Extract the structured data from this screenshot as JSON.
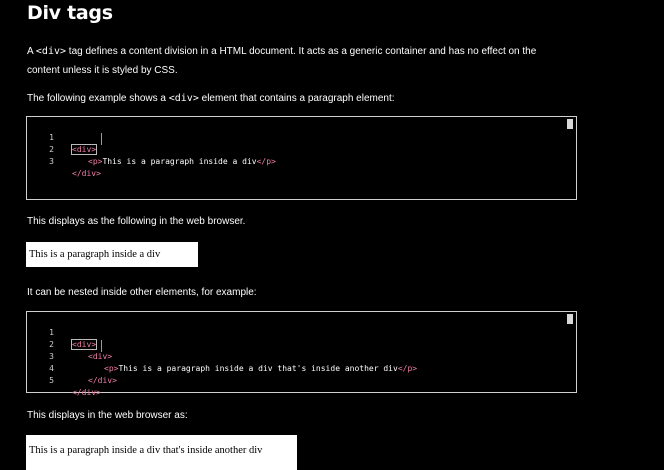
{
  "title": "Div tags",
  "intro": {
    "before": "A ",
    "code": "<div>",
    "after": " tag defines a content division in a HTML document. It acts as a generic container and has no effect on the content unless it is styled by CSS."
  },
  "example_intro": {
    "before": "The following example shows a ",
    "code": "<div>",
    "after": " element that contains a paragraph element:"
  },
  "editor1": {
    "lines": [
      {
        "num": "1",
        "open": "<div>",
        "text": "",
        "close": ""
      },
      {
        "num": "2",
        "open": "<p>",
        "text": "This is a paragraph inside a div",
        "close": "</p>"
      },
      {
        "num": "3",
        "open": "</div>",
        "text": "",
        "close": ""
      }
    ]
  },
  "displays_label": "This displays as the following in the web browser.",
  "output1": "This is a paragraph inside a div",
  "nested_label": "It can be nested inside other elements, for example:",
  "editor2": {
    "lines": [
      {
        "num": "1",
        "open": "<div>",
        "text": "",
        "close": ""
      },
      {
        "num": "2",
        "open": "<div>",
        "text": "",
        "close": ""
      },
      {
        "num": "3",
        "open": "<p>",
        "text": "This is a paragraph inside a div that's inside another div",
        "close": "</p>"
      },
      {
        "num": "4",
        "open": "</div>",
        "text": "",
        "close": ""
      },
      {
        "num": "5",
        "open": "</div>",
        "text": "",
        "close": ""
      }
    ]
  },
  "displays_label2": "This displays in the web browser as:",
  "output2": "This is a paragraph inside a div that's inside another div",
  "colors": {
    "background": "#000000",
    "tag": "#f07da8",
    "border": "#cfcfcf"
  }
}
